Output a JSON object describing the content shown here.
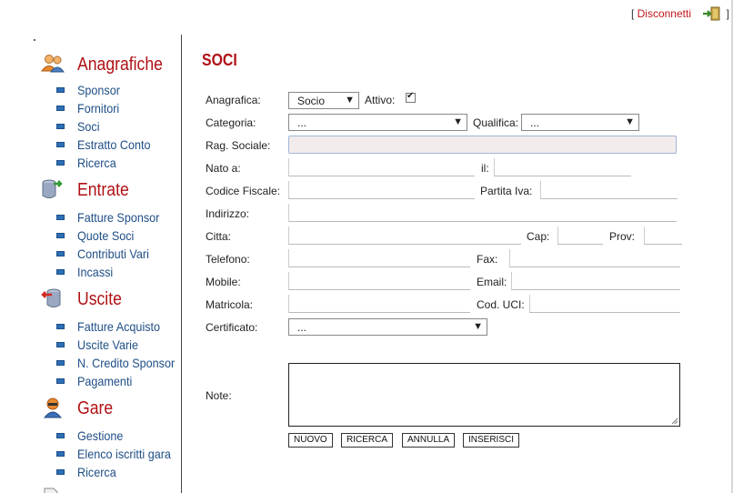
{
  "header": {
    "bracket_open": "[",
    "logout_label": "Disconnetti",
    "bracket_close": "]",
    "logout_icon": "exit-door-icon"
  },
  "sidebar": {
    "sections": [
      {
        "title": "Anagrafiche",
        "icon": "people-icon",
        "items": [
          "Sponsor",
          "Fornitori",
          "Soci",
          "Estratto Conto",
          "Ricerca"
        ]
      },
      {
        "title": "Entrate",
        "icon": "database-in-icon",
        "items": [
          "Fatture Sponsor",
          "Quote Soci",
          "Contributi Vari",
          "Incassi"
        ]
      },
      {
        "title": "Uscite",
        "icon": "database-out-icon",
        "items": [
          "Fatture Acquisto",
          "Uscite Varie",
          "N. Credito Sponsor",
          "Pagamenti"
        ]
      },
      {
        "title": "Gare",
        "icon": "racer-icon",
        "items": [
          "Gestione",
          "Elenco iscritti gara",
          "Ricerca"
        ]
      }
    ]
  },
  "page": {
    "title": "SOCI"
  },
  "form": {
    "anagrafica_label": "Anagrafica:",
    "anagrafica_value": "Socio",
    "attivo_label": "Attivo:",
    "attivo_checked": true,
    "categoria_label": "Categoria:",
    "categoria_value": "...",
    "qualifica_label": "Qualifica:",
    "qualifica_value": "...",
    "rag_sociale_label": "Rag. Sociale:",
    "nato_label": "Nato a:",
    "il_label": "il:",
    "codice_fiscale_label": "Codice Fiscale:",
    "partita_iva_label": "Partita Iva:",
    "indirizzo_label": "Indirizzo:",
    "citta_label": "Citta:",
    "cap_label": "Cap:",
    "prov_label": "Prov:",
    "telefono_label": "Telefono:",
    "fax_label": "Fax:",
    "mobile_label": "Mobile:",
    "email_label": "Email:",
    "matricola_label": "Matricola:",
    "cod_uci_label": "Cod. UCI:",
    "certificato_label": "Certificato:",
    "certificato_value": "...",
    "note_label": "Note:"
  },
  "buttons": {
    "nuovo": "NUOVO",
    "ricerca": "RICERCA",
    "annulla": "ANNULLA",
    "inserisci": "INSERISCI"
  },
  "colors": {
    "accent_red": "#b01115",
    "link_blue": "#1f4f86",
    "bullet_blue": "#2c6fb6"
  }
}
